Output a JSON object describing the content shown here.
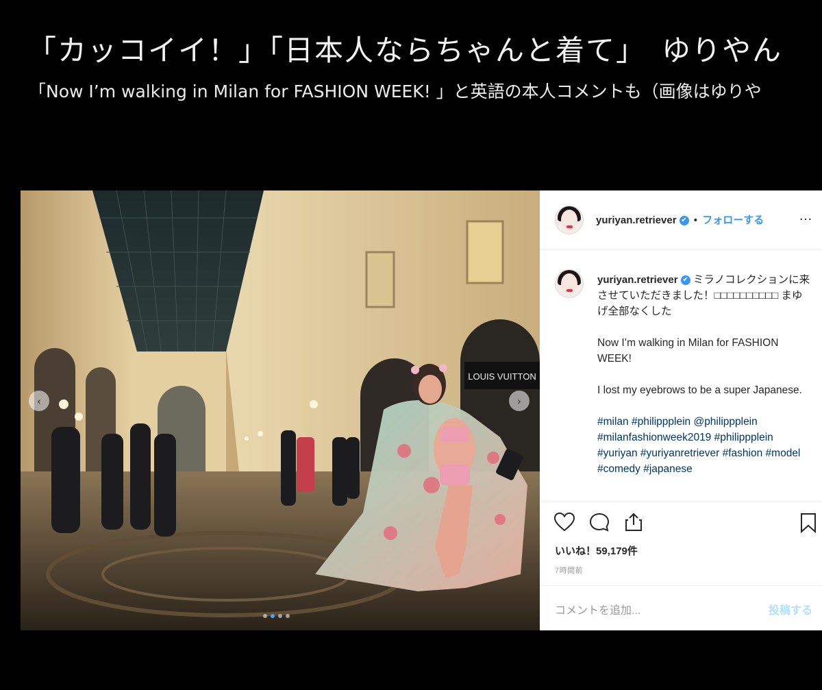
{
  "headline": "「カッコイイ！」「日本人ならちゃんと着て」　ゆりやん",
  "subheadline": "「Now I’m walking in Milan for FASHION WEEK! 」と英語の本人コメントも（画像はゆりや",
  "post": {
    "username": "yuriyan.retriever",
    "verified_mark": "✔",
    "separator": "•",
    "follow_label": "フォローする",
    "more_label": "…",
    "caption_username": "yuriyan.retriever",
    "caption_jp": "ミラノコレクションに来させていただきました！□□□□□□□□□□ まゆげ全部なくした",
    "caption_en_1": "Now I’m walking in Milan for FASHION WEEK!",
    "caption_en_2": "I lost my eyebrows to be a super Japanese.",
    "hashtags": "#milan #philippplein @philippplein #milanfashionweek2019 #philippplein #yuriyan #yuriyanretriever #fashion #model #comedy #japanese",
    "likes": "いいね！59,179件",
    "time": "7時間前",
    "comment_placeholder": "コメントを追加...",
    "post_button": "投稿する",
    "photo_sign": "LOUIS VUITTON",
    "carousel_prev": "‹",
    "carousel_next": "›",
    "dots_total": 4,
    "dots_active_index": 1
  },
  "colors": {
    "page_bg": "#000000",
    "link_blue": "#3897f0",
    "hashtag_blue": "#003569",
    "post_disabled": "#b2dffc"
  }
}
